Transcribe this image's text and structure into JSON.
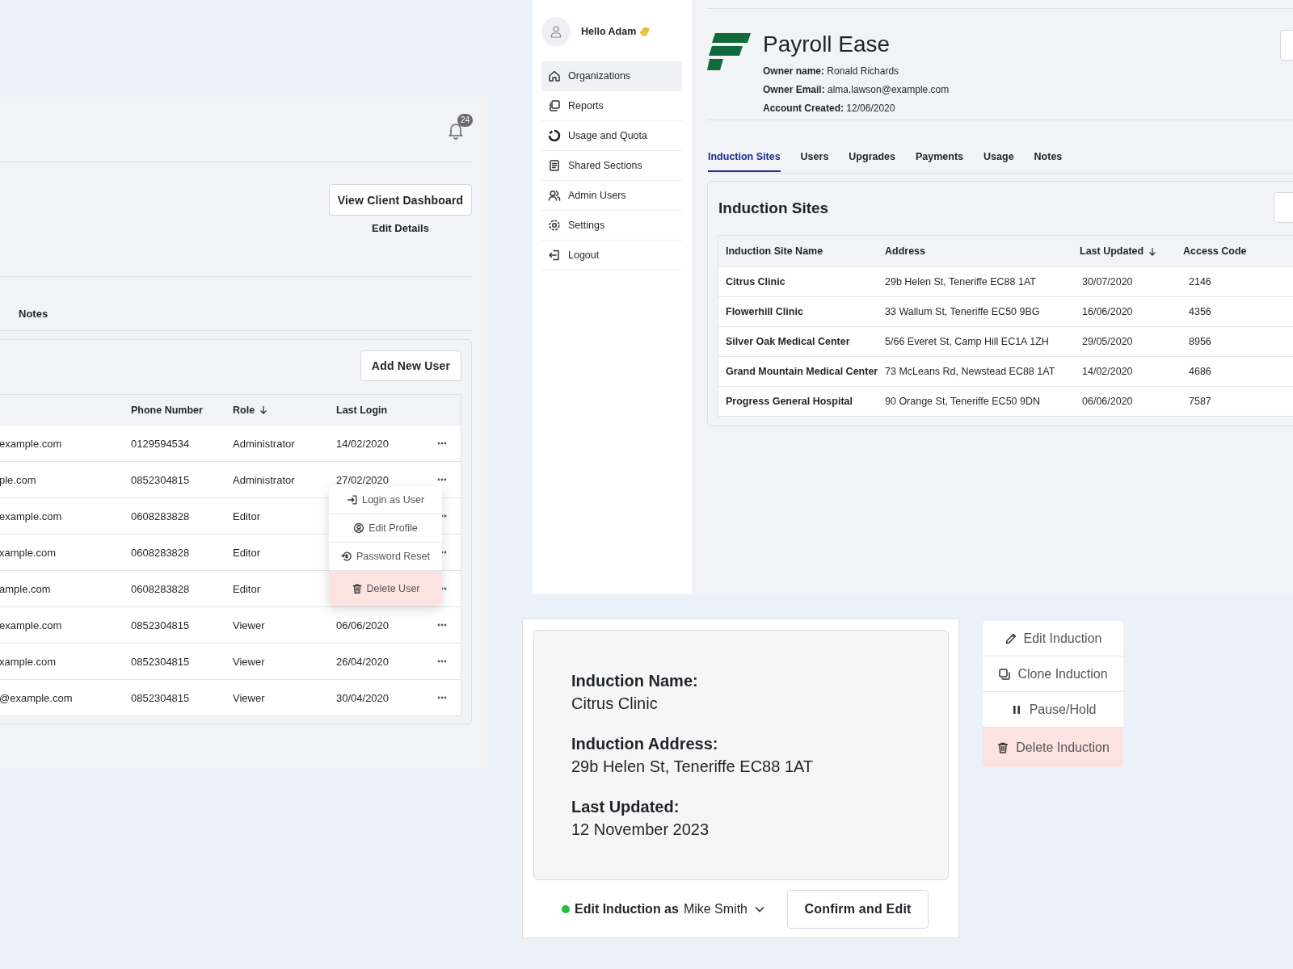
{
  "users_panel": {
    "notification_count": "24",
    "dashboard_button": "View Client Dashboard",
    "edit_link": "Edit Details",
    "tabs": [
      {
        "label": "Notes",
        "selected": false
      }
    ],
    "add_button": "Add New User",
    "table": {
      "columns": [
        {
          "label": "Phone Number",
          "sorted": false
        },
        {
          "label": "Role",
          "sorted": true
        },
        {
          "label": "Last Login",
          "sorted": false
        }
      ],
      "rows": [
        {
          "email": "example.com",
          "phone": "0129594534",
          "role": "Administrator",
          "last_login": "14/02/2020"
        },
        {
          "email": "ple.com",
          "phone": "0852304815",
          "role": "Administrator",
          "last_login": "27/02/2020"
        },
        {
          "email": "example.com",
          "phone": "0608283828",
          "role": "Editor"
        },
        {
          "email": "xample.com",
          "phone": "0608283828",
          "role": "Editor"
        },
        {
          "email": "ample.com",
          "phone": "0608283828",
          "role": "Editor"
        },
        {
          "email": "example.com",
          "phone": "0852304815",
          "role": "Viewer",
          "last_login": "06/06/2020"
        },
        {
          "email": "xample.com",
          "phone": "0852304815",
          "role": "Viewer",
          "last_login": "26/04/2020"
        },
        {
          "email": "@example.com",
          "phone": "0852304815",
          "role": "Viewer",
          "last_login": "30/04/2020"
        }
      ]
    },
    "row_menu": [
      {
        "label": "Login as User",
        "kind": "login",
        "danger": false
      },
      {
        "label": "Edit Profile",
        "kind": "profile",
        "danger": false
      },
      {
        "label": "Password Reset",
        "kind": "reset",
        "danger": false
      },
      {
        "label": "Delete User",
        "kind": "delete",
        "danger": true
      }
    ]
  },
  "sidebar": {
    "greeting": "Hello Adam",
    "items": [
      {
        "label": "Organizations",
        "kind": "home",
        "selected": true
      },
      {
        "label": "Reports",
        "kind": "copy",
        "selected": false
      },
      {
        "label": "Usage and Quota",
        "kind": "quota",
        "selected": false
      },
      {
        "label": "Shared Sections",
        "kind": "document",
        "selected": false
      },
      {
        "label": "Admin Users",
        "kind": "users",
        "selected": false
      },
      {
        "label": "Settings",
        "kind": "settings",
        "selected": false
      },
      {
        "label": "Logout",
        "kind": "logout",
        "selected": false
      }
    ]
  },
  "organization": {
    "name": "Payroll Ease",
    "details": [
      {
        "label": "Owner name:",
        "value": "Ronald Richards"
      },
      {
        "label": "Owner Email:",
        "value": "alma.lawson@example.com"
      },
      {
        "label": "Account Created:",
        "value": "12/06/2020"
      }
    ],
    "tabs": [
      {
        "label": "Induction Sites",
        "selected": true
      },
      {
        "label": "Users",
        "selected": false
      },
      {
        "label": "Upgrades",
        "selected": false
      },
      {
        "label": "Payments",
        "selected": false
      },
      {
        "label": "Usage",
        "selected": false
      },
      {
        "label": "Notes",
        "selected": false
      }
    ],
    "sites": {
      "title": "Induction Sites",
      "columns": [
        {
          "label": "Induction Site Name",
          "sorted": false
        },
        {
          "label": "Address",
          "sorted": false
        },
        {
          "label": "Last Updated",
          "sorted": true
        },
        {
          "label": "Access Code",
          "sorted": false
        }
      ],
      "rows": [
        {
          "name": "Citrus Clinic",
          "address": "29b Helen St, Teneriffe EC88 1AT",
          "last_updated": "30/07/2020",
          "access_code": "2146"
        },
        {
          "name": "Flowerhill Clinic",
          "address": "33 Wallum St, Teneriffe EC50 9BG",
          "last_updated": "16/06/2020",
          "access_code": "4356"
        },
        {
          "name": "Silver Oak Medical Center",
          "address": "5/66 Everet St, Camp Hill EC1A 1ZH",
          "last_updated": "29/05/2020",
          "access_code": "8956"
        },
        {
          "name": "Grand Mountain Medical Center",
          "address": "73 McLeans Rd, Newstead EC88 1AT",
          "last_updated": "14/02/2020",
          "access_code": "4686"
        },
        {
          "name": "Progress General Hospital",
          "address": "90 Orange St, Teneriffe EC50 9DN",
          "last_updated": "06/06/2020",
          "access_code": "7587"
        }
      ]
    }
  },
  "induction_detail": {
    "fields": [
      {
        "label": "Induction Name:",
        "value": "Citrus Clinic"
      },
      {
        "label": "Induction Address:",
        "value": "29b Helen St, Teneriffe EC88 1AT"
      },
      {
        "label": "Last Updated:",
        "value": "12 November 2023"
      }
    ],
    "edit_as": {
      "label": "Edit Induction as",
      "user": "Mike Smith",
      "color": "#22c03c"
    },
    "confirm_button": "Confirm and Edit"
  },
  "induction_menu": [
    {
      "label": "Edit Induction",
      "kind": "edit",
      "danger": false
    },
    {
      "label": "Clone Induction",
      "kind": "clone",
      "danger": false
    },
    {
      "label": "Pause/Hold",
      "kind": "pause",
      "danger": false
    },
    {
      "label": "Delete Induction",
      "kind": "delete",
      "danger": true
    }
  ]
}
